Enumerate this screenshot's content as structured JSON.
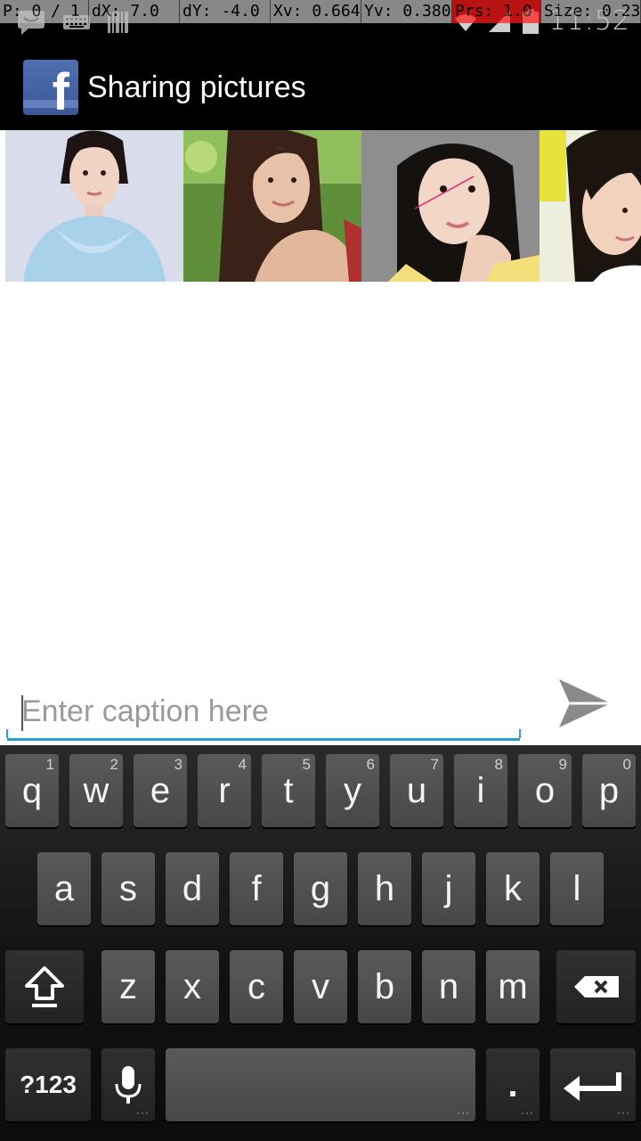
{
  "debug_overlay": {
    "pointer": "P: 0 / 1",
    "dx": "dX: 7.0",
    "dy": "dY: -4.0",
    "xv": "Xv: 0.664",
    "yv": "Yv: 0.380",
    "prs": "Prs: 1.0",
    "size": "Size: 0.23"
  },
  "status_bar": {
    "time": "11:52",
    "icons": [
      "chat-notification-icon",
      "keyboard-icon",
      "barcode-icon",
      "wifi-icon",
      "signal-icon",
      "battery-icon"
    ]
  },
  "action_bar": {
    "title": "Sharing pictures",
    "logo_letter": "f"
  },
  "photos": [
    {
      "name": "photo-1"
    },
    {
      "name": "photo-2"
    },
    {
      "name": "photo-3"
    },
    {
      "name": "photo-4"
    }
  ],
  "caption": {
    "placeholder": "Enter caption here",
    "value": ""
  },
  "keyboard": {
    "row1": [
      {
        "label": "q",
        "hint": "1"
      },
      {
        "label": "w",
        "hint": "2"
      },
      {
        "label": "e",
        "hint": "3"
      },
      {
        "label": "r",
        "hint": "4"
      },
      {
        "label": "t",
        "hint": "5"
      },
      {
        "label": "y",
        "hint": "6"
      },
      {
        "label": "u",
        "hint": "7"
      },
      {
        "label": "i",
        "hint": "8"
      },
      {
        "label": "o",
        "hint": "9"
      },
      {
        "label": "p",
        "hint": "0"
      }
    ],
    "row2": [
      "a",
      "s",
      "d",
      "f",
      "g",
      "h",
      "j",
      "k",
      "l"
    ],
    "row3": [
      "z",
      "x",
      "c",
      "v",
      "b",
      "n",
      "m"
    ],
    "symbols_label": "?123",
    "period_label": "."
  },
  "colors": {
    "accent": "#2a9fd6",
    "facebook_blue": "#3b5998",
    "debug_alert": "#ff1a1a"
  }
}
